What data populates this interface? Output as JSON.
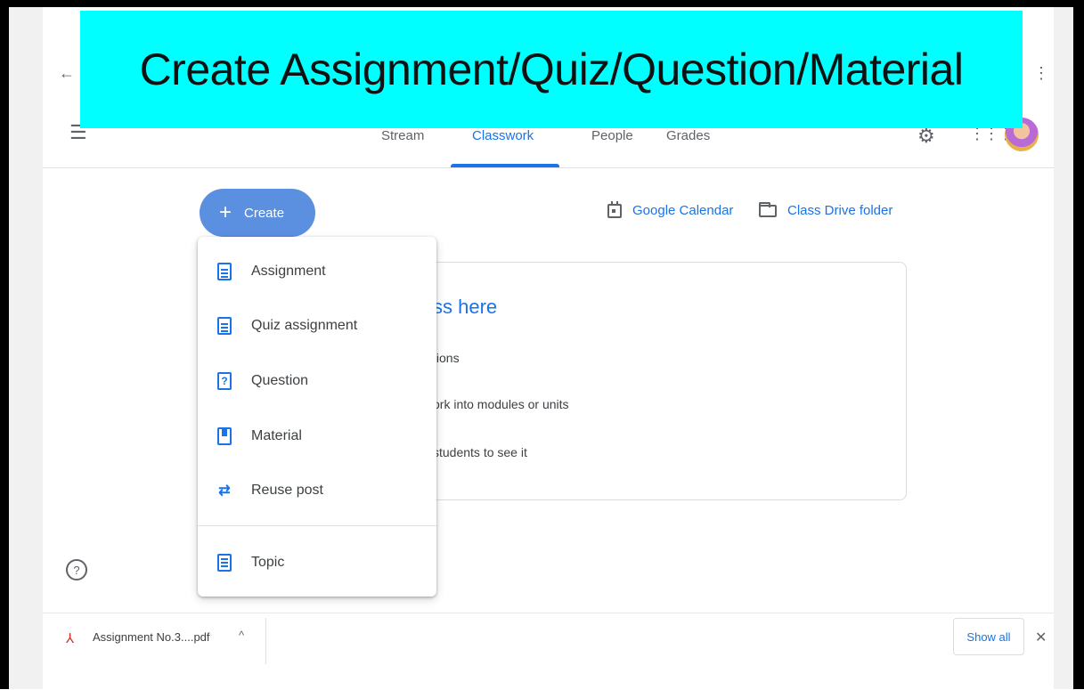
{
  "banner": {
    "title": "Create Assignment/Quiz/Question/Material"
  },
  "nav": {
    "tabs": [
      {
        "label": "Stream"
      },
      {
        "label": "Classwork",
        "active": true
      },
      {
        "label": "People"
      },
      {
        "label": "Grades"
      }
    ]
  },
  "toolbar": {
    "create_label": "Create",
    "calendar_link": "Google Calendar",
    "drive_link": "Class Drive folder"
  },
  "create_menu": {
    "items": [
      {
        "label": "Assignment",
        "icon": "assignment-icon"
      },
      {
        "label": "Quiz assignment",
        "icon": "quiz-icon"
      },
      {
        "label": "Question",
        "icon": "question-icon"
      },
      {
        "label": "Material",
        "icon": "material-icon"
      },
      {
        "label": "Reuse post",
        "icon": "reuse-icon"
      },
      {
        "label": "Topic",
        "icon": "topic-icon"
      }
    ]
  },
  "card": {
    "title_fragment": "ss here",
    "lines": [
      "tions",
      "ork into modules or units",
      "students to see it"
    ]
  },
  "downloads": {
    "file_name": "Assignment  No.3....pdf",
    "show_all": "Show all"
  },
  "colors": {
    "accent": "#1a73e8",
    "banner": "#00ffff",
    "create_button": "#5b8fe0"
  }
}
